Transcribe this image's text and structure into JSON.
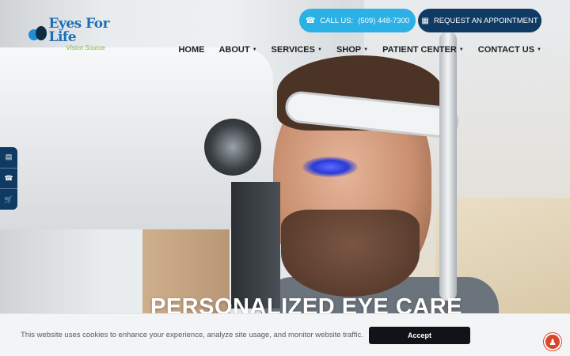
{
  "brand": {
    "name": "Eyes For Life",
    "tagline": "Vision Source"
  },
  "header": {
    "call_label": "CALL US:",
    "call_number": "(509) 448-7300",
    "appointment_label": "REQUEST AN APPOINTMENT",
    "call_icon": "phone-icon",
    "appointment_icon": "calendar-icon"
  },
  "nav": {
    "items": [
      {
        "label": "HOME",
        "dropdown": false
      },
      {
        "label": "ABOUT",
        "dropdown": true
      },
      {
        "label": "SERVICES",
        "dropdown": true
      },
      {
        "label": "SHOP",
        "dropdown": true
      },
      {
        "label": "PATIENT CENTER",
        "dropdown": true
      },
      {
        "label": "CONTACT US",
        "dropdown": true
      }
    ]
  },
  "side_tabs": {
    "icons": [
      "id-card-icon",
      "phone-icon",
      "cart-icon"
    ]
  },
  "hero": {
    "heading": "PERSONALIZED EYE CARE"
  },
  "cookie_banner": {
    "text": "This website uses cookies to enhance your experience, analyze site usage, and monitor website traffic.",
    "accept_label": "Accept"
  },
  "accessibility": {
    "icon": "accessibility-icon"
  },
  "colors": {
    "call_button": "#2bb1e6",
    "appointment_button": "#0f3a63",
    "accept_button": "#101418",
    "accessibility": "#d9472b",
    "logo_blue": "#1c6fb8",
    "logo_green": "#7fb83a"
  }
}
